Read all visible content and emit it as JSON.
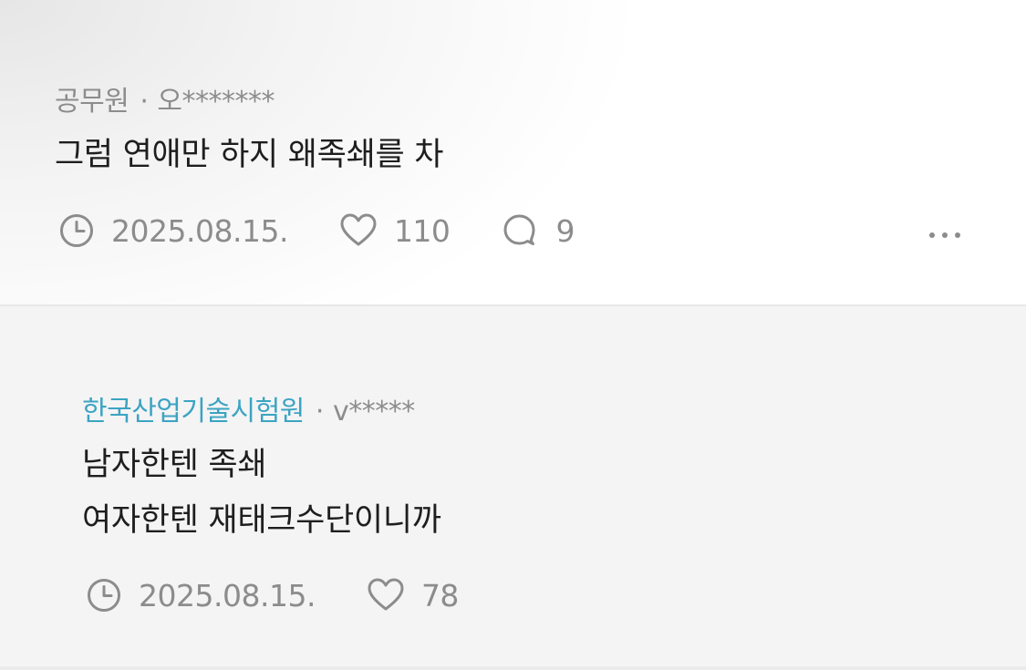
{
  "post": {
    "company": "공무원",
    "separator": "·",
    "author": "오*******",
    "content": "그럼 연애만 하지 왜족쇄를 차",
    "date": "2025.08.15.",
    "likes": "110",
    "comments": "9",
    "icons": [
      "clock-icon",
      "heart-icon",
      "comment-icon",
      "more-icon"
    ]
  },
  "reply": {
    "company": "한국산업기술시험원",
    "separator": "·",
    "author": "v*****",
    "content_lines": [
      "남자한텐 족쇄",
      "여자한텐 재태크수단이니까"
    ],
    "date": "2025.08.15.",
    "likes": "78",
    "icons": [
      "clock-icon",
      "heart-icon"
    ]
  },
  "colors": {
    "meta_gray": "#8c8c8c",
    "company_accent": "#3ba4c2",
    "text": "#1e1e1e",
    "reply_background": "#f4f4f5"
  }
}
